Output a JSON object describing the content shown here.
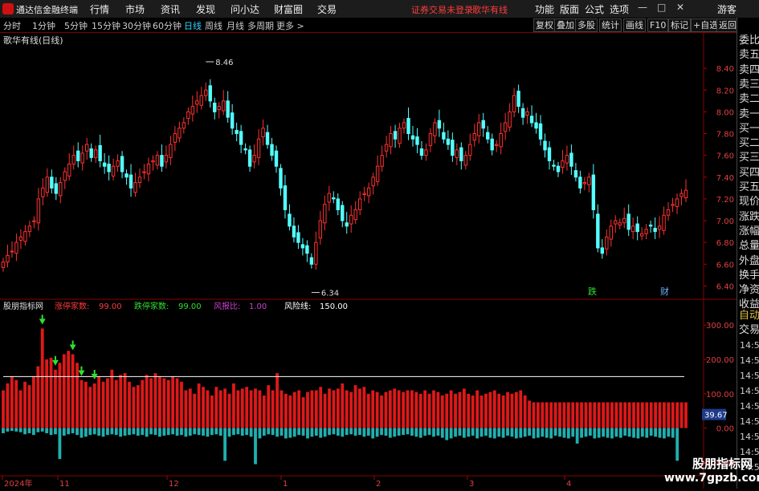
{
  "menubar": {
    "app_title": "通达信金融终端",
    "items": [
      "行情",
      "市场",
      "资讯",
      "发现",
      "问小达",
      "财富圈",
      "交易"
    ],
    "notice": "证券交易未登录",
    "stock": "歌华有线",
    "right_items": [
      "功能",
      "版面",
      "公式",
      "选项"
    ],
    "window_buttons": [
      "—",
      "□",
      "✕"
    ],
    "user": "游客"
  },
  "periodbar": {
    "periods": [
      "分时",
      "1分钟",
      "5分钟",
      "15分钟",
      "30分钟",
      "60分钟",
      "日线",
      "周线",
      "月线",
      "多周期",
      "更多 >"
    ],
    "active_period": "日线",
    "tools": [
      "复权",
      "叠加",
      "多股",
      "统计",
      "画线",
      "F10",
      "标记",
      "+自选",
      "返回"
    ]
  },
  "main_chart": {
    "title": "歌华有线(日线)",
    "high_label": "8.46",
    "low_label": "6.34",
    "markers": [
      "跌",
      "财"
    ]
  },
  "indicator": {
    "name": "股朋指标网",
    "fields": [
      {
        "label": "涨停家数:",
        "value": "99.00",
        "color": "#ff3b3b"
      },
      {
        "label": "跌停家数:",
        "value": "99.00",
        "color": "#30e030"
      },
      {
        "label": "风报比:",
        "value": "1.00",
        "color": "#d040d0"
      },
      {
        "label": "风险线:",
        "value": "150.00",
        "color": "#ffffff"
      }
    ],
    "current_value": "39.67"
  },
  "x_axis": {
    "labels": [
      "2024年",
      "11",
      "12",
      "1",
      "2",
      "3",
      "4"
    ]
  },
  "side_panel": {
    "top": [
      "委比",
      "卖五",
      "卖四",
      "卖三",
      "卖二",
      "卖一",
      "买一",
      "买二",
      "买三",
      "买四",
      "买五",
      "现价",
      "涨跌",
      "涨幅",
      "总量",
      "外盘",
      "换手",
      "净资",
      "收益"
    ],
    "auto_label": "自动",
    "trade_label": "交易",
    "times": [
      "14:56",
      "14:56",
      "14:56",
      "14:56",
      "14:56",
      "14:56",
      "14:56",
      "14:56",
      "14:56"
    ]
  },
  "watermark": {
    "line1": "股朋指标网",
    "line2": "www.7gpzb.com"
  },
  "chart_data": [
    {
      "type": "candlestick",
      "title": "歌华有线(日线)",
      "ylim": [
        6.3,
        8.6
      ],
      "yticks": [
        8.4,
        8.2,
        8.0,
        7.8,
        7.6,
        7.4,
        7.2,
        7.0,
        6.8,
        6.6,
        6.4
      ],
      "close": [
        6.62,
        6.68,
        6.72,
        6.8,
        6.85,
        6.9,
        6.95,
        7.0,
        7.2,
        7.3,
        7.4,
        7.3,
        7.25,
        7.35,
        7.45,
        7.52,
        7.6,
        7.55,
        7.62,
        7.7,
        7.58,
        7.65,
        7.55,
        7.5,
        7.45,
        7.5,
        7.55,
        7.45,
        7.4,
        7.3,
        7.35,
        7.4,
        7.45,
        7.52,
        7.55,
        7.6,
        7.5,
        7.6,
        7.7,
        7.8,
        7.85,
        7.9,
        8.0,
        8.05,
        8.1,
        8.15,
        8.2,
        8.1,
        8.0,
        8.05,
        8.1,
        7.95,
        7.85,
        7.8,
        7.7,
        7.65,
        7.5,
        7.6,
        7.75,
        7.85,
        7.7,
        7.6,
        7.5,
        7.3,
        7.1,
        6.95,
        6.85,
        6.8,
        6.75,
        6.7,
        6.6,
        6.8,
        7.0,
        7.15,
        7.25,
        7.2,
        7.1,
        7.0,
        6.95,
        7.05,
        7.1,
        7.2,
        7.25,
        7.3,
        7.4,
        7.5,
        7.6,
        7.7,
        7.8,
        7.75,
        7.85,
        7.9,
        7.8,
        7.75,
        7.7,
        7.6,
        7.65,
        7.8,
        7.9,
        7.85,
        7.75,
        7.7,
        7.6,
        7.65,
        7.55,
        7.6,
        7.7,
        7.8,
        7.9,
        7.85,
        7.75,
        7.65,
        7.7,
        7.8,
        7.9,
        8.0,
        8.15,
        8.05,
        7.95,
        8.0,
        7.9,
        7.85,
        7.75,
        7.65,
        7.55,
        7.5,
        7.45,
        7.55,
        7.6,
        7.5,
        7.4,
        7.3,
        7.35,
        7.4,
        7.1,
        6.75,
        6.7,
        6.85,
        6.95,
        7.0,
        6.98,
        7.02,
        6.92,
        6.95,
        6.9,
        6.88,
        6.92,
        6.95,
        6.9,
        6.95,
        7.05,
        7.1,
        7.15,
        7.2,
        7.25,
        7.28
      ],
      "high_label": 8.46,
      "low_label": 6.34
    },
    {
      "type": "bar",
      "name": "股朋指标网",
      "ylim": [
        -120,
        340
      ],
      "yticks": [
        300,
        200,
        100,
        0,
        -100
      ],
      "risk_line": 150,
      "arrows_at": [
        9,
        12,
        16,
        18,
        21
      ],
      "red": [
        110,
        130,
        150,
        140,
        110,
        135,
        125,
        150,
        180,
        290,
        200,
        205,
        170,
        190,
        215,
        225,
        215,
        190,
        140,
        135,
        120,
        130,
        150,
        135,
        145,
        170,
        140,
        155,
        160,
        135,
        120,
        125,
        140,
        155,
        145,
        160,
        150,
        145,
        140,
        150,
        145,
        135,
        110,
        115,
        100,
        130,
        120,
        110,
        95,
        120,
        110,
        115,
        100,
        130,
        110,
        115,
        120,
        110,
        115,
        110,
        95,
        125,
        110,
        160,
        110,
        100,
        95,
        105,
        110,
        90,
        105,
        110,
        110,
        120,
        100,
        115,
        110,
        115,
        130,
        110,
        105,
        125,
        115,
        120,
        100,
        110,
        105,
        95,
        105,
        110,
        115,
        110,
        105,
        110,
        110,
        105,
        100,
        110,
        100,
        110,
        105,
        95,
        100,
        110,
        100,
        105,
        115,
        100,
        95,
        110,
        95,
        100,
        105,
        110,
        100,
        95,
        105,
        100,
        105,
        110,
        95,
        80,
        75,
        75,
        75,
        75,
        75,
        75,
        75,
        75,
        75,
        75,
        75,
        75,
        75,
        75,
        75,
        75,
        75,
        75,
        75,
        75,
        75,
        75,
        75,
        75,
        75,
        75,
        75,
        75,
        75,
        75,
        75,
        75,
        75,
        75,
        75,
        75
      ],
      "cyan": [
        -15,
        -10,
        -8,
        -10,
        -12,
        -18,
        -15,
        -20,
        -12,
        -10,
        -15,
        -20,
        -18,
        -90,
        -22,
        -18,
        -15,
        -20,
        -28,
        -25,
        -20,
        -18,
        -22,
        -25,
        -20,
        -18,
        -20,
        -25,
        -22,
        -20,
        -18,
        -22,
        -20,
        -25,
        -18,
        -20,
        -25,
        -22,
        -20,
        -18,
        -22,
        -20,
        -25,
        -22,
        -18,
        -20,
        -22,
        -25,
        -20,
        -18,
        -22,
        -95,
        -25,
        -20,
        -18,
        -22,
        -20,
        -25,
        -105,
        -30,
        -22,
        -18,
        -20,
        -25,
        -22,
        -30,
        -28,
        -25,
        -20,
        -22,
        -30,
        -25,
        -22,
        -28,
        -25,
        -20,
        -18,
        -22,
        -25,
        -20,
        -18,
        -22,
        -20,
        -25,
        -22,
        -30,
        -25,
        -20,
        -22,
        -28,
        -25,
        -22,
        -20,
        -18,
        -22,
        -25,
        -28,
        -22,
        -20,
        -25,
        -22,
        -28,
        -35,
        -30,
        -25,
        -22,
        -28,
        -25,
        -22,
        -30,
        -25,
        -22,
        -28,
        -30,
        -25,
        -28,
        -22,
        -25,
        -30,
        -28,
        -25,
        -22,
        -30,
        -28,
        -25,
        -28,
        -30,
        -22,
        -25,
        -28,
        -30,
        -25,
        -45,
        -28,
        -25,
        -22,
        -30,
        -28,
        -25,
        -28,
        -30,
        -25,
        -28,
        -22,
        -25,
        -28,
        -30,
        -25,
        -28,
        -22,
        -25,
        -28,
        -30,
        -25,
        -28,
        -95
      ]
    }
  ]
}
